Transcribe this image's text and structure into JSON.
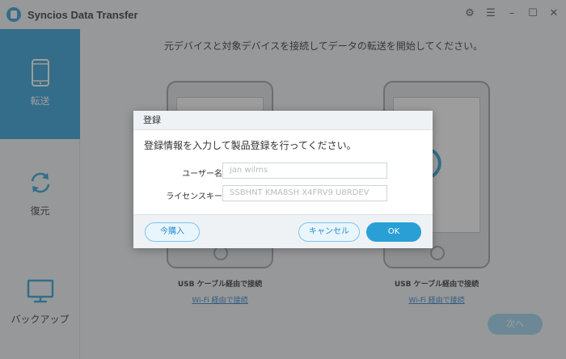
{
  "window": {
    "title": "Syncios Data Transfer"
  },
  "sidebar": {
    "items": [
      {
        "label": "転送",
        "icon": "phone-icon",
        "active": true
      },
      {
        "label": "復元",
        "icon": "refresh-icon",
        "active": false
      },
      {
        "label": "バックアップ",
        "icon": "monitor-icon",
        "active": false
      }
    ]
  },
  "main": {
    "headline": "元デバイスと対象デバイスを接続してデータの転送を開始してください。",
    "left_device": {
      "usb_label": "USB ケーブル経由で接続",
      "wifi_label": "Wi-Fi 経由で接続"
    },
    "right_device": {
      "usb_label": "USB ケーブル経由で接続",
      "wifi_label": "Wi-Fi 経由で接続"
    },
    "next_label": "次へ"
  },
  "dialog": {
    "title": "登録",
    "message": "登録情報を入力して製品登録を行ってください。",
    "username_label": "ユーザー名",
    "username_value": "jan wilms",
    "license_label": "ライセンスキー",
    "license_value": "SSBHNT KMA8SH X4FRV9 U8RDEV",
    "buy_label": "今購入",
    "cancel_label": "キャンセル",
    "ok_label": "OK"
  },
  "colors": {
    "accent": "#2a9fd6",
    "link": "#2a7fc6"
  }
}
